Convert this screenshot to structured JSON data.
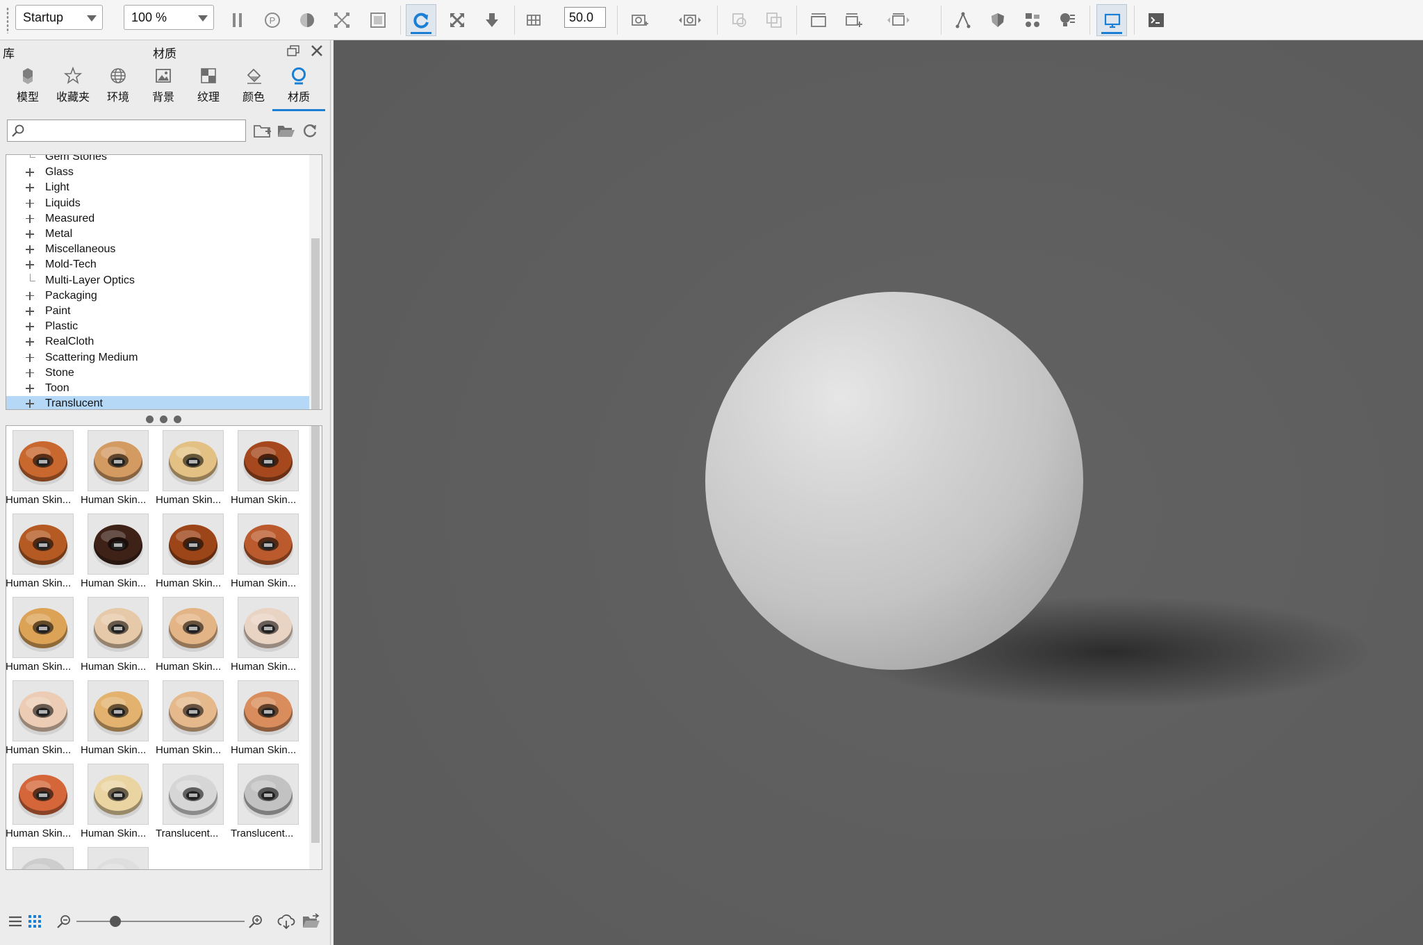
{
  "toolbar": {
    "preset_value": "Startup",
    "zoom_value": "100 %",
    "numeric_value": "50.0"
  },
  "panel": {
    "library_label": "库",
    "title": "材质",
    "tabs": [
      {
        "label": "模型",
        "icon": "model-icon"
      },
      {
        "label": "收藏夹",
        "icon": "star-icon"
      },
      {
        "label": "环境",
        "icon": "globe-icon"
      },
      {
        "label": "背景",
        "icon": "image-icon"
      },
      {
        "label": "纹理",
        "icon": "checker-icon"
      },
      {
        "label": "颜色",
        "icon": "paint-bucket-icon"
      },
      {
        "label": "材质",
        "icon": "material-ball-icon"
      }
    ],
    "active_tab": 6,
    "search_placeholder": ""
  },
  "tree": {
    "items": [
      {
        "name": "Gem Stones",
        "expandable": false,
        "partial": true
      },
      {
        "name": "Glass",
        "expandable": true
      },
      {
        "name": "Light",
        "expandable": true
      },
      {
        "name": "Liquids",
        "expandable": true
      },
      {
        "name": "Measured",
        "expandable": true
      },
      {
        "name": "Metal",
        "expandable": true
      },
      {
        "name": "Miscellaneous",
        "expandable": true
      },
      {
        "name": "Mold-Tech",
        "expandable": true
      },
      {
        "name": "Multi-Layer Optics",
        "expandable": false
      },
      {
        "name": "Packaging",
        "expandable": true
      },
      {
        "name": "Paint",
        "expandable": true
      },
      {
        "name": "Plastic",
        "expandable": true
      },
      {
        "name": "RealCloth",
        "expandable": true
      },
      {
        "name": "Scattering Medium",
        "expandable": true
      },
      {
        "name": "Stone",
        "expandable": true
      },
      {
        "name": "Toon",
        "expandable": true
      },
      {
        "name": "Translucent",
        "expandable": true,
        "selected": true
      }
    ]
  },
  "materials": [
    {
      "label": "Human Skin...",
      "color": "#c8672e"
    },
    {
      "label": "Human Skin...",
      "color": "#d39a62"
    },
    {
      "label": "Human Skin...",
      "color": "#e3c184"
    },
    {
      "label": "Human Skin...",
      "color": "#a5481e"
    },
    {
      "label": "Human Skin...",
      "color": "#b45a22"
    },
    {
      "label": "Human Skin...",
      "color": "#3e2218"
    },
    {
      "label": "Human Skin...",
      "color": "#9c4518"
    },
    {
      "label": "Human Skin...",
      "color": "#bb5b2d"
    },
    {
      "label": "Human Skin...",
      "color": "#dca255"
    },
    {
      "label": "Human Skin...",
      "color": "#e6c9a8"
    },
    {
      "label": "Human Skin...",
      "color": "#e3b486"
    },
    {
      "label": "Human Skin...",
      "color": "#e9d3c3"
    },
    {
      "label": "Human Skin...",
      "color": "#ecccb4"
    },
    {
      "label": "Human Skin...",
      "color": "#e2b26e"
    },
    {
      "label": "Human Skin...",
      "color": "#e6b98c"
    },
    {
      "label": "Human Skin...",
      "color": "#d98d5c"
    },
    {
      "label": "Human Skin...",
      "color": "#d4663a"
    },
    {
      "label": "Human Skin...",
      "color": "#ead4a2"
    },
    {
      "label": "Translucent...",
      "color": "#d6d6d6"
    },
    {
      "label": "Translucent...",
      "color": "#c2c2c2"
    },
    {
      "label": "",
      "color": "#cdcdcd"
    },
    {
      "label": "",
      "color": "#dedede"
    }
  ],
  "zoom_slider_fraction": 0.23,
  "viewport": {
    "background": "#5f5f5f",
    "sphere_color": "#d8d8d8"
  }
}
